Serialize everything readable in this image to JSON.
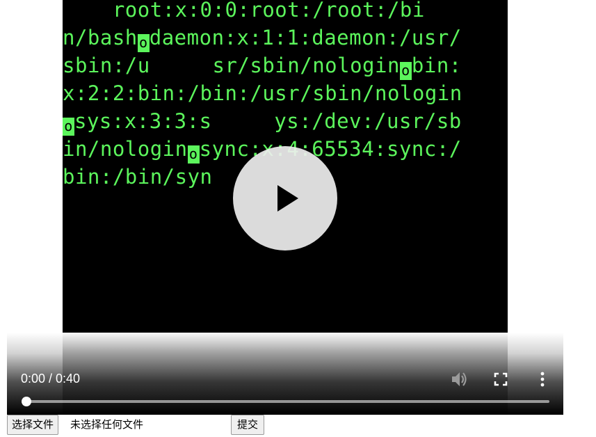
{
  "video": {
    "terminal_lines": [
      "    root:x:0:0:root:/root:/bi",
      "n/bash",
      "daemon:x:1:1:daemon:/usr/",
      "sbin:/u     sr/sbin/nologin",
      "bin:",
      "x:2:2:bin:/bin:/usr/sbin/nologin",
      "sys:x:3:3:s     ys:/dev:/usr/sb",
      "in/nologin",
      "sync:x:4:65534:sync:/",
      "bin:/bin/syn"
    ],
    "cursor_glyph": "o",
    "time_display": "0:00 / 0:40",
    "progress_fraction": 0,
    "icons": {
      "play": "play-icon",
      "mute": "volume-icon",
      "fullscreen": "fullscreen-icon",
      "more": "more-vertical-icon"
    },
    "text_color": "#5cf55c"
  },
  "form": {
    "file_button_label": "选择文件",
    "file_status": "未选择任何文件",
    "submit_label": "提交"
  }
}
